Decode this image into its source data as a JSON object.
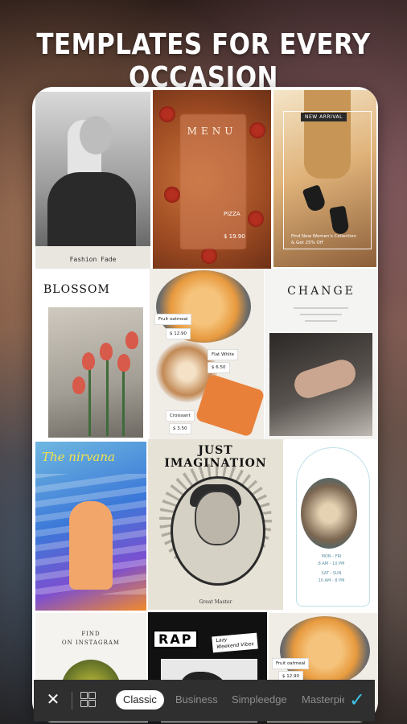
{
  "headline": "TEMPLATES FOR EVERY OCCASION",
  "templates": {
    "fashion": {
      "caption": "Fashion Fade"
    },
    "menu": {
      "title": "MENU",
      "dish": "PIZZA",
      "price": "$ 19.90"
    },
    "arrival": {
      "badge": "NEW ARRIVAL",
      "promo_line1": "Find New Women's Collection",
      "promo_line2": "& Get 25% Off"
    },
    "blossom": {
      "title": "BLOSSOM"
    },
    "food": {
      "tag1_name": "Fruit oatmeal",
      "tag1_price": "$ 12.90",
      "tag2_name": "Flat White",
      "tag2_price": "$ 6.50",
      "tag3_name": "Croissant",
      "tag3_price": "$ 3.50"
    },
    "change": {
      "title": "CHANGE"
    },
    "nirvana": {
      "title": "The nirvana"
    },
    "imagination": {
      "title": "JUST IMAGINATION",
      "caption": "Great Master"
    },
    "cafe": {
      "hours1": "MON - FRI",
      "hours2": "8 AM - 10 PM",
      "hours3": "SAT - SUN",
      "hours4": "10 AM - 8 PM"
    },
    "instagram": {
      "line1": "FIND",
      "line2": "ON INSTAGRAM"
    },
    "rap": {
      "label": "RAP",
      "note_line1": "Lazy",
      "note_line2": "Weekend Vibes"
    },
    "food2": {
      "tag_name": "Fruit oatmeal",
      "tag_price": "$ 12.90"
    }
  },
  "toolbar": {
    "close_icon": "close-icon",
    "layout_icon": "layout-grid-icon",
    "tabs": [
      {
        "label": "Classic",
        "active": true
      },
      {
        "label": "Business",
        "active": false
      },
      {
        "label": "Simpleedge",
        "active": false
      },
      {
        "label": "Masterpiece",
        "active": false
      }
    ],
    "confirm_icon": "checkmark-icon",
    "accent_color": "#3fc1e3"
  }
}
